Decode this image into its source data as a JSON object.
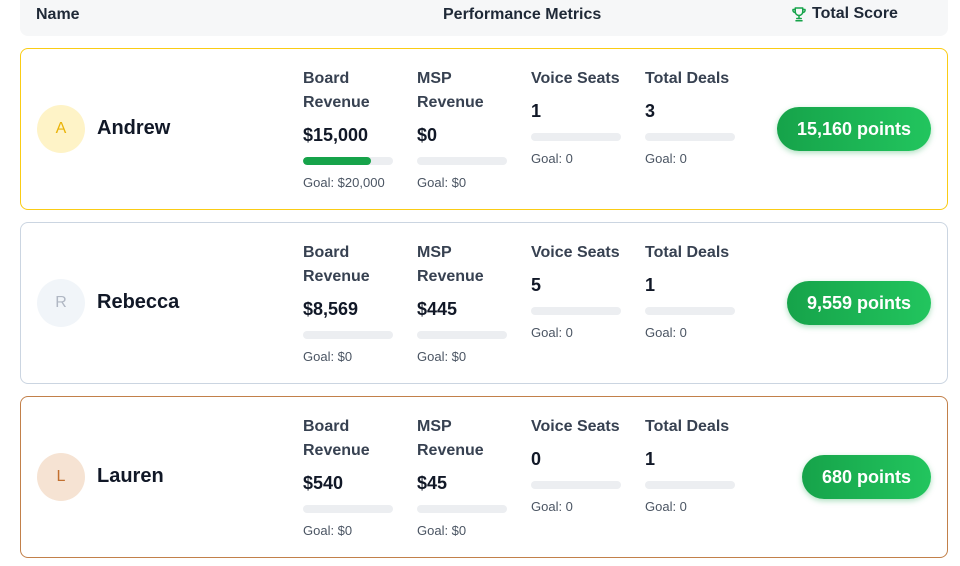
{
  "header": {
    "name": "Name",
    "metrics": "Performance Metrics",
    "total": "Total Score"
  },
  "colors": {
    "progress": "#16a34a",
    "score_gradient_start": "#16a34a",
    "score_gradient_end": "#22c55e",
    "gold": "#facc15",
    "bronze": "#c2804a"
  },
  "rows": [
    {
      "initial": "A",
      "name": "Andrew",
      "board_label": "Board Revenue",
      "board_value": "$15,000",
      "board_progress": 0.75,
      "board_goal": "Goal: $20,000",
      "msp_label": "MSP Revenue",
      "msp_value": "$0",
      "msp_progress": 0,
      "msp_goal": "Goal: $0",
      "voice_label": "Voice Seats",
      "voice_value": "1",
      "voice_progress": 0,
      "voice_goal": "Goal: 0",
      "deals_label": "Total Deals",
      "deals_value": "3",
      "deals_progress": 0,
      "deals_goal": "Goal: 0",
      "score": "15,160 points"
    },
    {
      "initial": "R",
      "name": "Rebecca",
      "board_label": "Board Revenue",
      "board_value": "$8,569",
      "board_progress": 0,
      "board_goal": "Goal: $0",
      "msp_label": "MSP Revenue",
      "msp_value": "$445",
      "msp_progress": 0,
      "msp_goal": "Goal: $0",
      "voice_label": "Voice Seats",
      "voice_value": "5",
      "voice_progress": 0,
      "voice_goal": "Goal: 0",
      "deals_label": "Total Deals",
      "deals_value": "1",
      "deals_progress": 0,
      "deals_goal": "Goal: 0",
      "score": "9,559 points"
    },
    {
      "initial": "L",
      "name": "Lauren",
      "board_label": "Board Revenue",
      "board_value": "$540",
      "board_progress": 0,
      "board_goal": "Goal: $0",
      "msp_label": "MSP Revenue",
      "msp_value": "$45",
      "msp_progress": 0,
      "msp_goal": "Goal: $0",
      "voice_label": "Voice Seats",
      "voice_value": "0",
      "voice_progress": 0,
      "voice_goal": "Goal: 0",
      "deals_label": "Total Deals",
      "deals_value": "1",
      "deals_progress": 0,
      "deals_goal": "Goal: 0",
      "score": "680 points"
    }
  ]
}
